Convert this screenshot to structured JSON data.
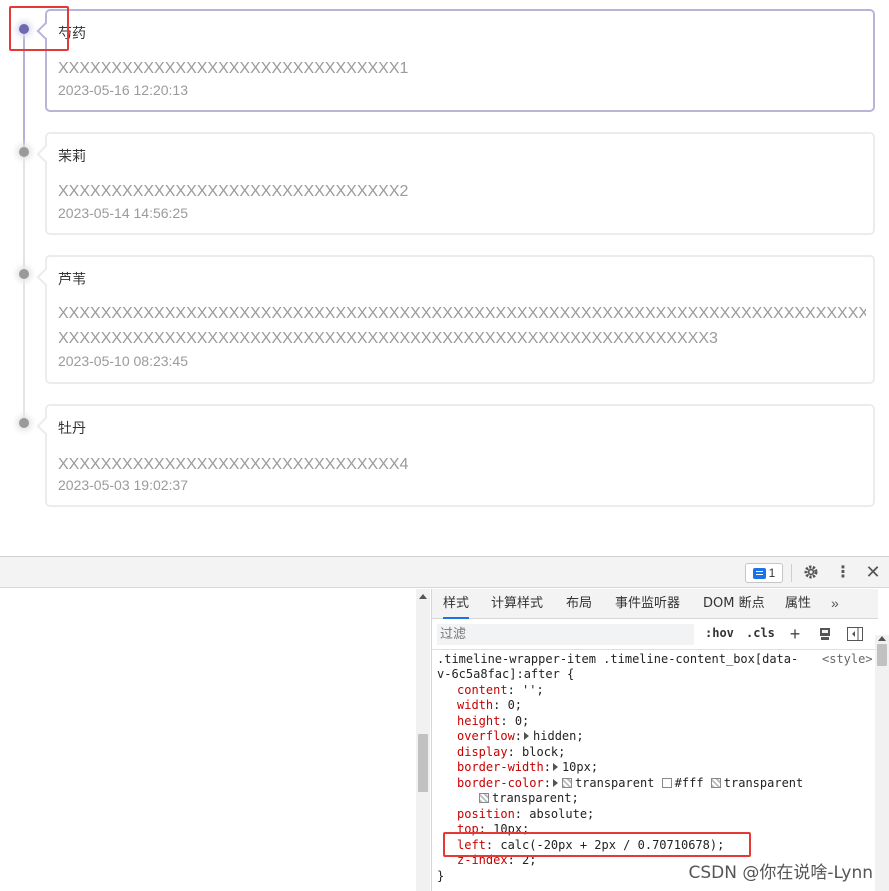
{
  "timeline": {
    "items": [
      {
        "title": "芍药",
        "content": "XXXXXXXXXXXXXXXXXXXXXXXXXXXXXXXX1",
        "time": "2023-05-16 12:20:13",
        "active": true
      },
      {
        "title": "茉莉",
        "content": "XXXXXXXXXXXXXXXXXXXXXXXXXXXXXXXX2",
        "time": "2023-05-14 14:56:25",
        "active": false
      },
      {
        "title": "芦苇",
        "content": "XXXXXXXXXXXXXXXXXXXXXXXXXXXXXXXXXXXXXXXXXXXXXXXXXXXXXXXXXXXXXXXXXXXXXXXXXXXXXXXXXXXXXXXXXXXXXXXXXXXXXXXXXXXXXXXXXXXXXXXXXXXXXXXXXXXXXXXXXXXXXX3",
        "time": "2023-05-10 08:23:45",
        "active": false
      },
      {
        "title": "牡丹",
        "content": "XXXXXXXXXXXXXXXXXXXXXXXXXXXXXXXX4",
        "time": "2023-05-03 19:02:37",
        "active": false
      }
    ],
    "content_line1_3": "XXXXXXXXXXXXXXXXXXXXXXXXXXXXXXXXXXXXXXXXXXXXXXXXXXXXXXXXXXXXXXXXXXXXXXXXXXXXXXXXXX",
    "content_line2_3": "XXXXXXXXXXXXXXXXXXXXXXXXXXXXXXXXXXXXXXXXXXXXXXXXXXXXXXXXXXXXX3"
  },
  "devtools": {
    "badge_count": "1",
    "tabs": [
      "样式",
      "计算样式",
      "布局",
      "事件监听器",
      "DOM 断点",
      "属性"
    ],
    "active_tab": "样式",
    "filter_placeholder": "过滤",
    "hov_label": ":hov",
    "cls_label": ".cls",
    "rule": {
      "selector_line1": ".timeline-wrapper-item .timeline-content_box[data-",
      "selector_line2": "v-6c5a8fac]:after {",
      "source": "<style>",
      "declarations": [
        {
          "prop": "content",
          "value": "'';"
        },
        {
          "prop": "width",
          "value": "0;"
        },
        {
          "prop": "height",
          "value": "0;"
        },
        {
          "prop": "overflow",
          "value": "hidden;"
        },
        {
          "prop": "display",
          "value": "block;"
        },
        {
          "prop": "border-width",
          "value": "10px;"
        },
        {
          "prop": "border-color",
          "value": "transparent #fff transparent"
        },
        {
          "prop": "position",
          "value": "absolute;"
        },
        {
          "prop": "top",
          "value": "10px;"
        },
        {
          "prop": "left",
          "value": "calc(-20px + 2px / 0.70710678);"
        },
        {
          "prop": "z-index",
          "value": "2;"
        }
      ],
      "border_color_wrap": "transparent;",
      "close": "}"
    }
  },
  "colors": {
    "accent": "#6d68b0",
    "highlight": "#e53935",
    "prop_red": "#c80000",
    "devtools_blue": "#1a73e8"
  },
  "watermark": "CSDN @你在说啥-Lynn"
}
